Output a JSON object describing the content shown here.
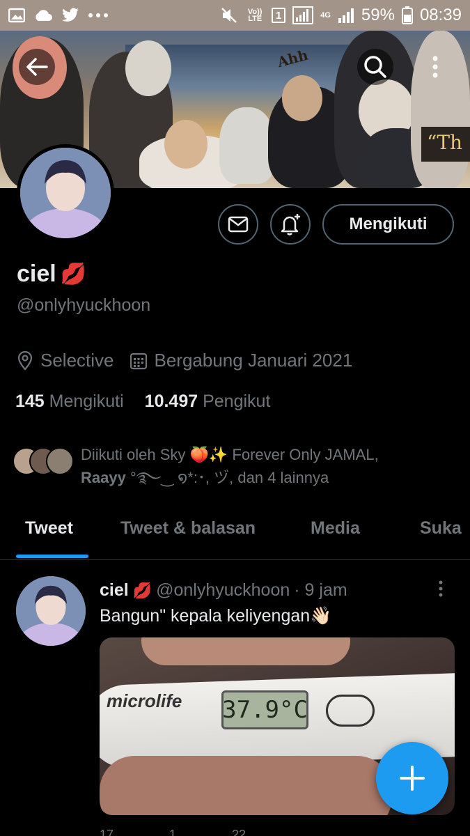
{
  "status_bar": {
    "volte": "Vo)) LTE",
    "sim": "1",
    "network": "4G",
    "battery": "59%",
    "time": "08:39",
    "icons": [
      "image-icon",
      "cloud-icon",
      "twitter-icon",
      "more-dots-icon",
      "mute-icon",
      "signal-icon",
      "battery-icon"
    ]
  },
  "profile": {
    "name": "ciel",
    "name_emoji": "💋",
    "handle": "@onlyhyuckhoon",
    "location": "Selective",
    "joined": "Bergabung Januari 2021",
    "following_count": "145",
    "following_label": "Mengikuti",
    "followers_count": "10.497",
    "followers_label": "Pengikut",
    "follow_button": "Mengikuti",
    "followed_by_line1": "Diikuti oleh Sky 🍑✨ Forever Only JAMAL,",
    "followed_by_bold": "Raayy",
    "followed_by_line2": " °࿐‿ ໑*:･, ヅ, dan 4 lainnya"
  },
  "banner": {
    "caption": "Ahh",
    "quote": "“Th"
  },
  "tabs": [
    "Tweet",
    "Tweet & balasan",
    "Media",
    "Suka"
  ],
  "tweet": {
    "name": "ciel",
    "name_emoji": "💋",
    "handle": "@onlyhyuckhoon",
    "time": "· 9 jam",
    "text": "Bangun\" kepala keliyengan👋🏻",
    "media_brand": "microlife",
    "media_reading": "37.9°C",
    "actions": [
      "17",
      "1",
      "22"
    ]
  },
  "colors": {
    "accent": "#1d9bf0",
    "muted": "#71767b",
    "background": "#000000",
    "border": "#536471"
  }
}
